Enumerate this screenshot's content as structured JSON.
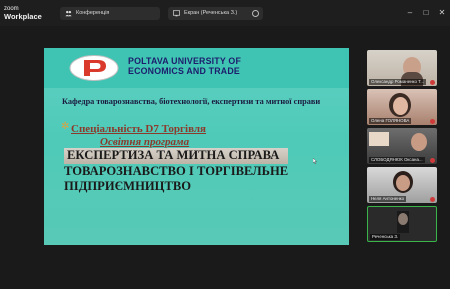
{
  "app": {
    "logo_line1": "zoom",
    "logo_line2": "Workplace"
  },
  "tabs": [
    {
      "label": "Конференція",
      "icon": "people-icon"
    },
    {
      "label": "Екран (Реченська З.)",
      "icon": "screen-share-icon"
    }
  ],
  "window_controls": [
    "minimize",
    "maximize",
    "close"
  ],
  "slide": {
    "university_line1": "POLTAVA UNIVERSITY OF",
    "university_line2": "ECONOMICS AND TRADE",
    "department": "Кафедра товарознавства, біотехнології, експертизи та митної справи",
    "specialty": "Спеціальність D7 Торгівля",
    "program_label": "Освітня програма",
    "program_title_lines": [
      "ЕКСПЕРТИЗА  ТА МИТНА СПРАВА",
      "ТОВАРОЗНАВСТВО І ТОРГІВЕЛЬНЕ",
      "ПІДПРИЄМНИЦТВО"
    ],
    "colors": {
      "background": "#4fcab8",
      "title": "#1a1a1a",
      "accent": "#8b3a2c",
      "logo_red": "#d93a2c"
    }
  },
  "participants": [
    {
      "name": "Олександр Романенко Т...",
      "muted": true
    },
    {
      "name": "Олена ГОЛЯНОВА",
      "muted": true
    },
    {
      "name": "СЛОБОДЯНЮК Оксана...",
      "muted": true
    },
    {
      "name": "Неля Антоненко",
      "muted": true
    },
    {
      "name": "Реченська З.",
      "muted": false,
      "active_speaker": true
    }
  ]
}
